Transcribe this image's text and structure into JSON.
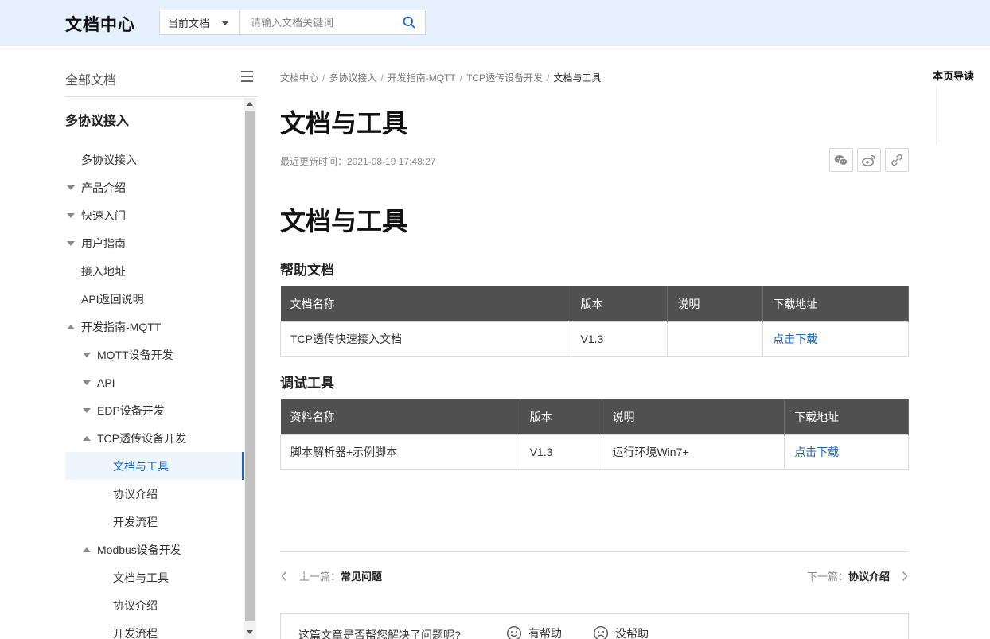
{
  "header": {
    "logo": "文档中心",
    "scope_label": "当前文档",
    "search_placeholder": "请输入文档关键词"
  },
  "sidebar": {
    "title": "全部文档",
    "section": "多协议接入",
    "items": [
      {
        "label": "多协议接入",
        "level": 1,
        "toggle": "none"
      },
      {
        "label": "产品介绍",
        "level": 1,
        "toggle": "down"
      },
      {
        "label": "快速入门",
        "level": 1,
        "toggle": "down"
      },
      {
        "label": "用户指南",
        "level": 1,
        "toggle": "down"
      },
      {
        "label": "接入地址",
        "level": 1,
        "toggle": "none"
      },
      {
        "label": "API返回说明",
        "level": 1,
        "toggle": "none"
      },
      {
        "label": "开发指南-MQTT",
        "level": 1,
        "toggle": "up"
      },
      {
        "label": "MQTT设备开发",
        "level": 2,
        "toggle": "down"
      },
      {
        "label": "API",
        "level": 2,
        "toggle": "down"
      },
      {
        "label": "EDP设备开发",
        "level": 2,
        "toggle": "down"
      },
      {
        "label": "TCP透传设备开发",
        "level": 2,
        "toggle": "up"
      },
      {
        "label": "文档与工具",
        "level": 3,
        "toggle": "none",
        "active": true
      },
      {
        "label": "协议介绍",
        "level": 3,
        "toggle": "none"
      },
      {
        "label": "开发流程",
        "level": 3,
        "toggle": "none"
      },
      {
        "label": "Modbus设备开发",
        "level": 2,
        "toggle": "up"
      },
      {
        "label": "文档与工具",
        "level": 3,
        "toggle": "none"
      },
      {
        "label": "协议介绍",
        "level": 3,
        "toggle": "none"
      },
      {
        "label": "开发流程",
        "level": 3,
        "toggle": "none"
      }
    ]
  },
  "breadcrumb": [
    "文档中心",
    "多协议接入",
    "开发指南-MQTT",
    "TCP透传设备开发",
    "文档与工具"
  ],
  "page": {
    "title": "文档与工具",
    "updated": "最近更新时间：2021-08-19 17:48:27",
    "content_title": "文档与工具"
  },
  "help_docs": {
    "title": "帮助文档",
    "headers": [
      "文档名称",
      "版本",
      "说明",
      "下载地址"
    ],
    "rows": [
      [
        "TCP透传快速接入文档",
        "V1.3",
        "",
        "点击下载"
      ]
    ]
  },
  "debug_tools": {
    "title": "调试工具",
    "headers": [
      "资料名称",
      "版本",
      "说明",
      "下载地址"
    ],
    "rows": [
      [
        "脚本解析器+示例脚本",
        "V1.3",
        "运行环境Win7+",
        "点击下载"
      ]
    ]
  },
  "pager": {
    "prev_label": "上一篇：",
    "prev_title": "常见问题",
    "next_label": "下一篇：",
    "next_title": "协议介绍"
  },
  "feedback": {
    "question": "这篇文章是否帮您解决了问题呢?",
    "yes": "有帮助",
    "no": "没帮助"
  },
  "toc": {
    "title": "本页导读"
  },
  "colors": {
    "accent": "#1a66c8",
    "header_bg": "#e6f0fd",
    "table_head": "#505050"
  }
}
